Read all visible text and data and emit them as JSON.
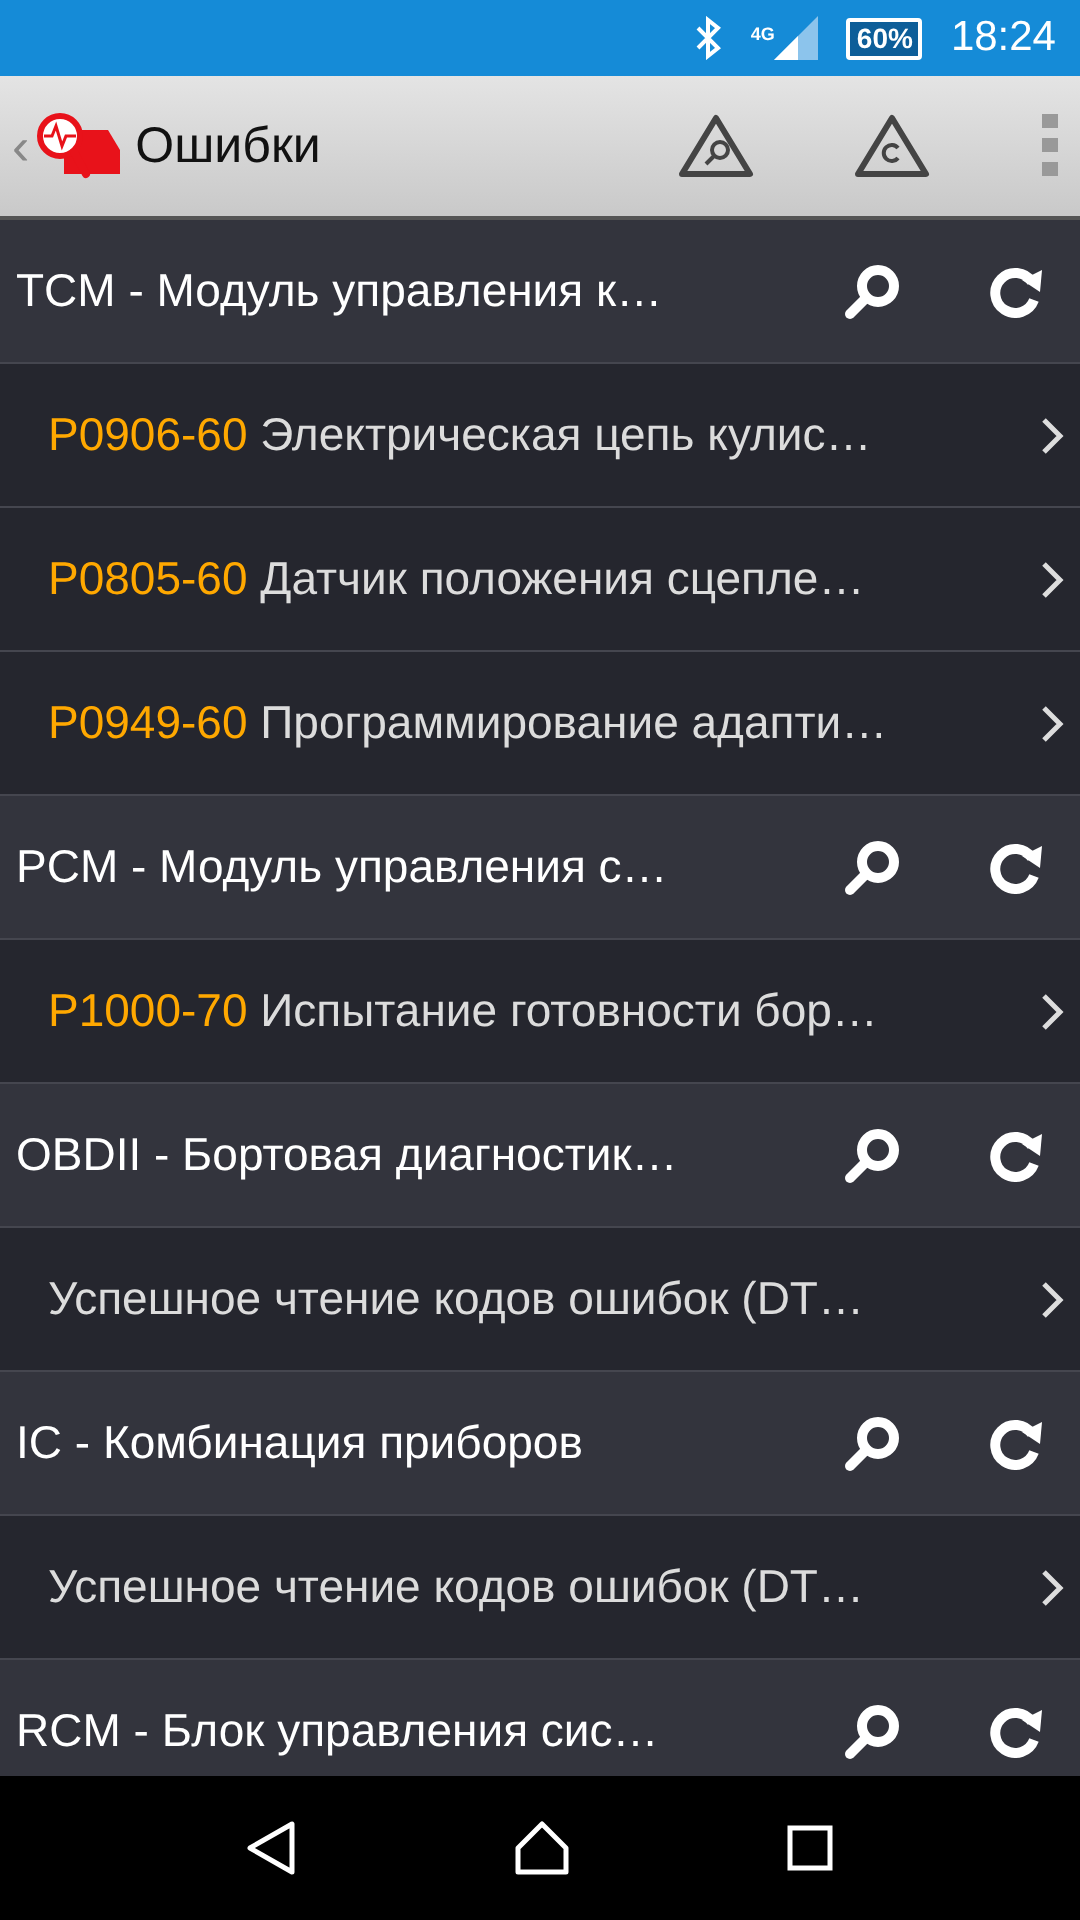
{
  "status_bar": {
    "network": "4G",
    "battery": "60%",
    "time": "18:24"
  },
  "app_bar": {
    "back": "‹",
    "title": "Ошибки"
  },
  "rows": [
    {
      "kind": "module",
      "text": "TCM - Модуль управления к…"
    },
    {
      "kind": "error",
      "code": "P0906-60",
      "text": "Электрическая цепь кулис…"
    },
    {
      "kind": "error",
      "code": "P0805-60",
      "text": "Датчик положения сцепле…"
    },
    {
      "kind": "error",
      "code": "P0949-60",
      "text": "Программирование адапти…"
    },
    {
      "kind": "module",
      "text": "PCM - Модуль управления с…"
    },
    {
      "kind": "error",
      "code": "P1000-70",
      "text": "Испытание готовности бор…"
    },
    {
      "kind": "module",
      "text": "OBDII - Бортовая диагностик…"
    },
    {
      "kind": "error",
      "text": "Успешное чтение кодов ошибок (DT…"
    },
    {
      "kind": "module",
      "text": "IC - Комбинация приборов"
    },
    {
      "kind": "error",
      "text": "Успешное чтение кодов ошибок (DT…"
    },
    {
      "kind": "module",
      "text": "RCM - Блок управления сис…"
    }
  ]
}
